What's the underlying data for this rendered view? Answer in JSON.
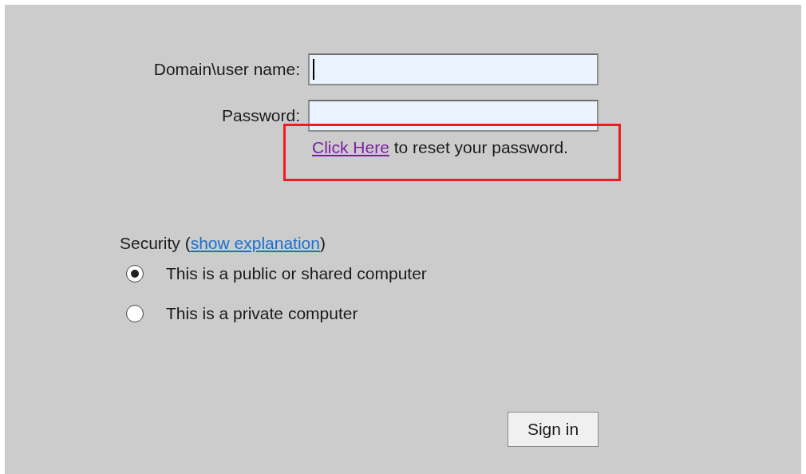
{
  "fields": [
    {
      "label": "Domain\\user name:",
      "focused": true
    },
    {
      "label": "Password:",
      "focused": false
    }
  ],
  "reset": {
    "link": "Click Here",
    "text": " to reset your password."
  },
  "security": {
    "prefix": "Security (",
    "link": "show explanation",
    "suffix": ")"
  },
  "radios": [
    {
      "label": "This is a public or shared computer",
      "selected": true
    },
    {
      "label": "This is a private computer",
      "selected": false
    }
  ],
  "button": "Sign in"
}
